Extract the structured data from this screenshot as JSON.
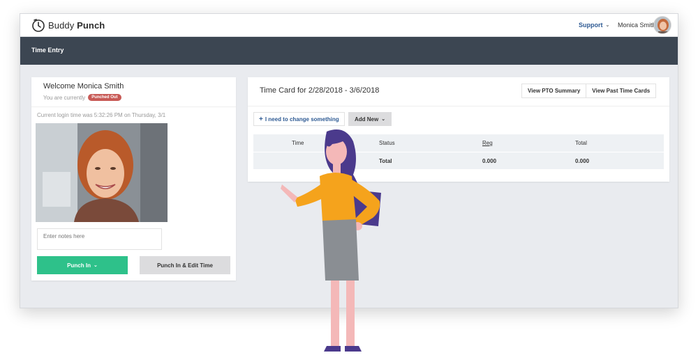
{
  "app": {
    "brand_light": "Buddy",
    "brand_bold": "Punch"
  },
  "header": {
    "support_label": "Support",
    "user_name": "Monica Smith"
  },
  "nav": {
    "tab_label": "Time Entry"
  },
  "left_panel": {
    "welcome": "Welcome Monica Smith",
    "currently_label": "You are currently",
    "status_badge": "Punched Out",
    "login_time": "Current login time was 5:32:26 PM on Thursday, 3/1",
    "notes_placeholder": "Enter notes here",
    "punch_in_label": "Punch In",
    "punch_edit_label": "Punch In & Edit Time"
  },
  "time_card": {
    "title": "Time Card for 2/28/2018 - 3/6/2018",
    "pto_summary_label": "View PTO Summary",
    "past_cards_label": "View Past Time Cards",
    "change_label": "I need to change something",
    "add_new_label": "Add New",
    "columns": [
      "Time",
      "Status",
      "Reg",
      "Total"
    ],
    "total_row": {
      "status": "Total",
      "reg": "0.000",
      "total": "0.000"
    }
  },
  "colors": {
    "nav_bg": "#3c4652",
    "punch_in_green": "#2ec18a",
    "badge_red": "#c85a56",
    "link_blue": "#2e5a93",
    "illustration_orange": "#f5a31c",
    "illustration_purple": "#4b3a8c"
  }
}
